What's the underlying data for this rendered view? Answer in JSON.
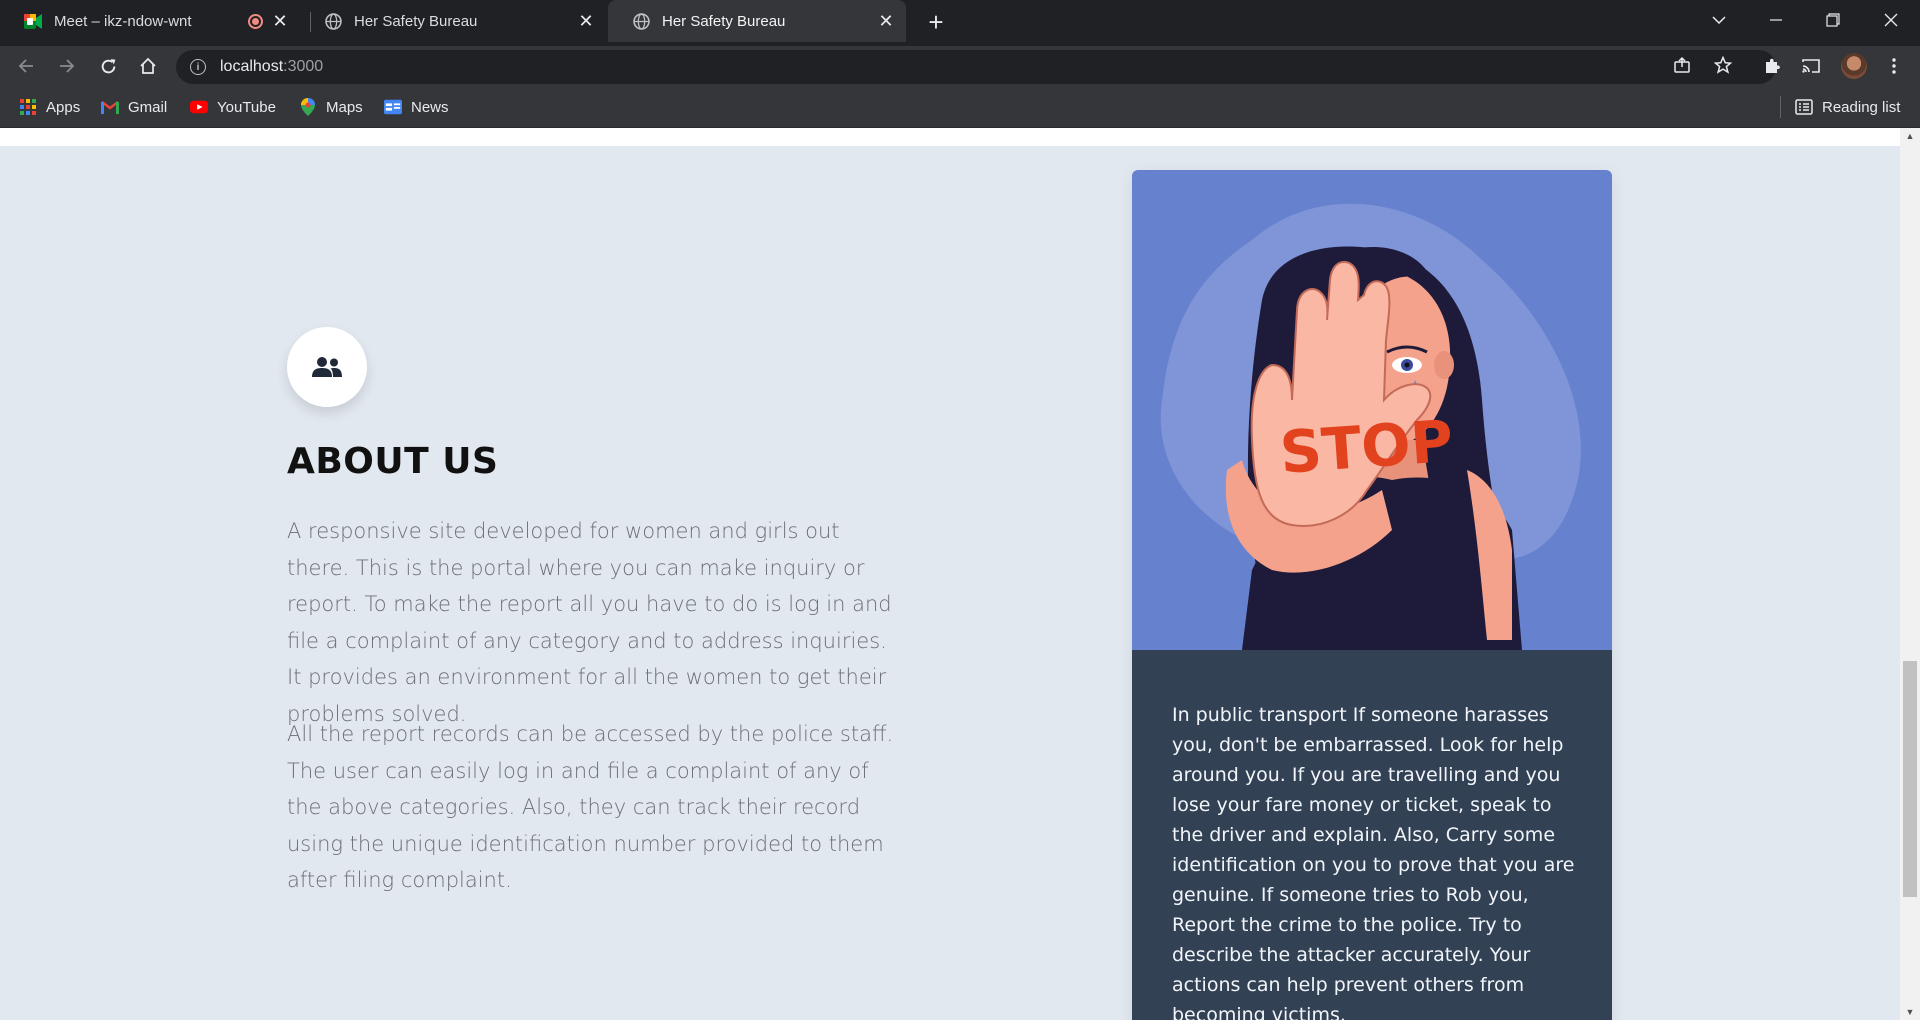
{
  "browser": {
    "tabs": [
      {
        "title": "Meet – ikz-ndow-wnt",
        "recording": true,
        "active": false
      },
      {
        "title": "Her Safety Bureau",
        "active": false
      },
      {
        "title": "Her Safety Bureau",
        "active": true
      }
    ],
    "address": {
      "host": "localhost",
      "port": ":3000"
    },
    "bookmarks": [
      "Apps",
      "Gmail",
      "YouTube",
      "Maps",
      "News"
    ],
    "reading_list": "Reading list"
  },
  "page": {
    "about": {
      "title": "ABOUT US",
      "icon": "users-icon",
      "paragraph1": "A responsive site developed for women and girls out there. This is the portal where you can make inquiry or report. To make the report all you have to do is log in and file a complaint of any category and to address inquiries. It provides an environment for all the women to get their problems solved.",
      "paragraph2": "All the report records can be accessed by the police staff. The user can easily log in and file a complaint of any of the above categories. Also, they can track their record using the unique identification number provided to them after filing complaint."
    },
    "card": {
      "image_sign_text": "STOP",
      "text": "In public transport If someone harasses you, don't be embarrassed. Look for help around you. If you are travelling and you lose your fare money or ticket, speak to the driver and explain. Also, Carry some identification on you to prove that you are genuine. If someone tries to Rob you, Report the crime to the police. Try to describe the attacker accurately. Your actions can help prevent others from becoming victims."
    }
  },
  "colors": {
    "page_bg": "#e2e8f0",
    "card_image_bg": "#6681cd",
    "card_body_bg": "#334155"
  }
}
